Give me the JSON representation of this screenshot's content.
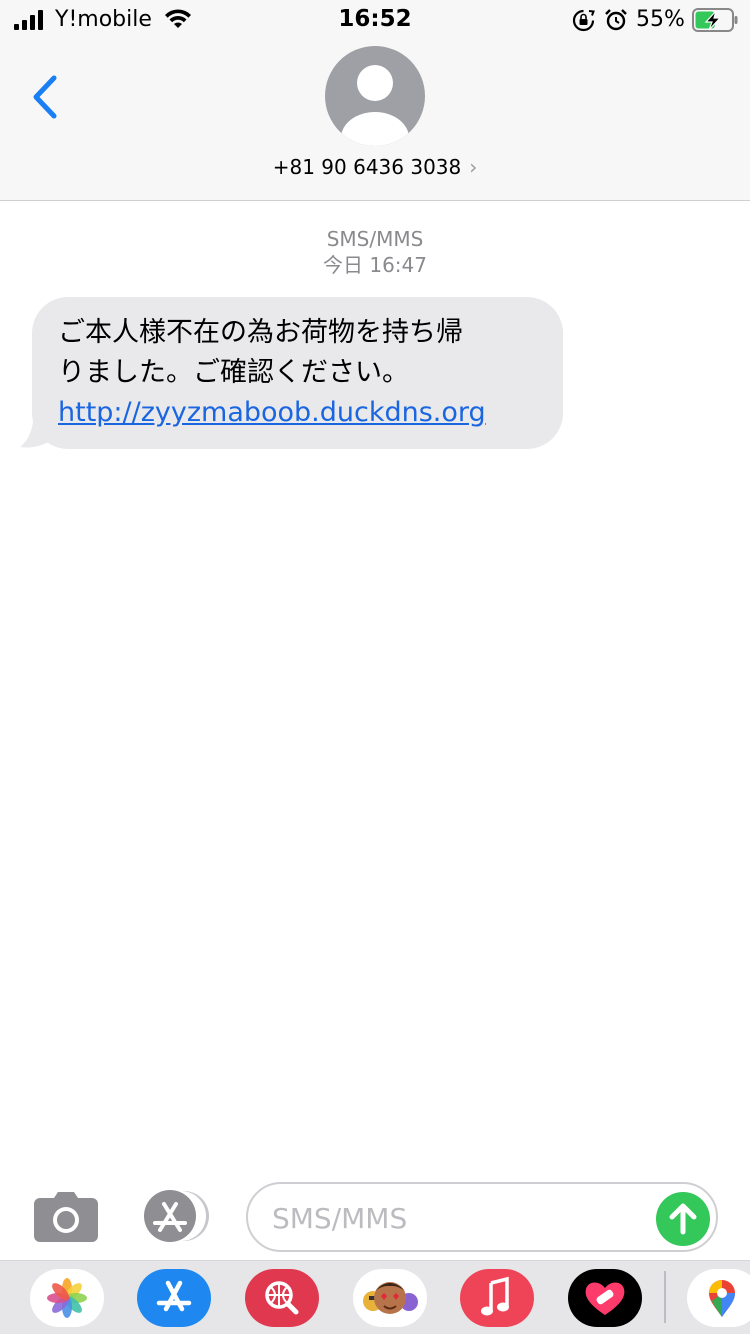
{
  "status_bar": {
    "carrier": "Y!mobile",
    "time": "16:52",
    "battery_percent": "55%",
    "battery_level": 0.55,
    "charging": true,
    "icons": [
      "signal-icon",
      "wifi-icon",
      "rotation-lock-icon",
      "alarm-icon",
      "battery-charging-icon"
    ]
  },
  "header": {
    "back_icon": "chevron-left-icon",
    "avatar_icon": "person-icon",
    "contact": "+81 90 6436 3038",
    "contact_chevron": "›"
  },
  "thread": {
    "service": "SMS/MMS",
    "timestamp": "今日 16:47",
    "messages": [
      {
        "direction": "incoming",
        "line1": "ご本人様不在の為お荷物を持ち帰",
        "line2": "りました。ご確認ください。",
        "link": "http://zyyzmaboob.duckdns.org"
      }
    ]
  },
  "compose": {
    "placeholder": "SMS/MMS",
    "value": "",
    "camera_icon": "camera-icon",
    "apps_icon": "app-store-icon",
    "send_icon": "arrow-up-icon"
  },
  "app_drawer": {
    "apps": [
      "photos-icon",
      "app-store-icon",
      "web-search-icon",
      "memoji-icon",
      "music-icon",
      "heart-stickers-icon",
      "maps-icon"
    ]
  },
  "colors": {
    "accent": "#1a66e0",
    "bubble_incoming": "#e9e9eb",
    "send": "#34c759",
    "header_bg": "#f7f7f7",
    "meta_text": "#8a8a8e"
  }
}
